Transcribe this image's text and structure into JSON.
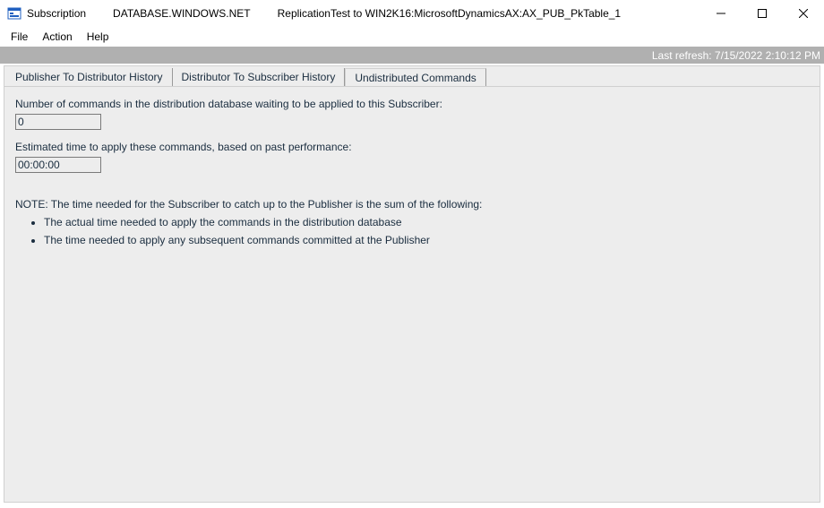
{
  "titlebar": {
    "app_label": "Subscription",
    "server": "DATABASE.WINDOWS.NET",
    "detail": "ReplicationTest to WIN2K16:MicrosoftDynamicsAX:AX_PUB_PkTable_1"
  },
  "menu": {
    "file": "File",
    "action": "Action",
    "help": "Help"
  },
  "status": {
    "last_refresh": "Last refresh: 7/15/2022 2:10:12 PM"
  },
  "tabs": {
    "pub_dist": "Publisher To Distributor History",
    "dist_sub": "Distributor To Subscriber History",
    "undist": "Undistributed Commands"
  },
  "panel": {
    "commands_label": "Number of commands in the distribution database waiting to be applied to this Subscriber:",
    "commands_value": "0",
    "time_label": "Estimated time to apply these commands, based on past performance:",
    "time_value": "00:00:00",
    "note_heading": "NOTE: The time needed for the Subscriber to catch up to the Publisher is the sum of the following:",
    "bullet1": "The actual time needed to apply the commands in the distribution database",
    "bullet2": "The time needed to apply any subsequent commands committed at the Publisher"
  }
}
